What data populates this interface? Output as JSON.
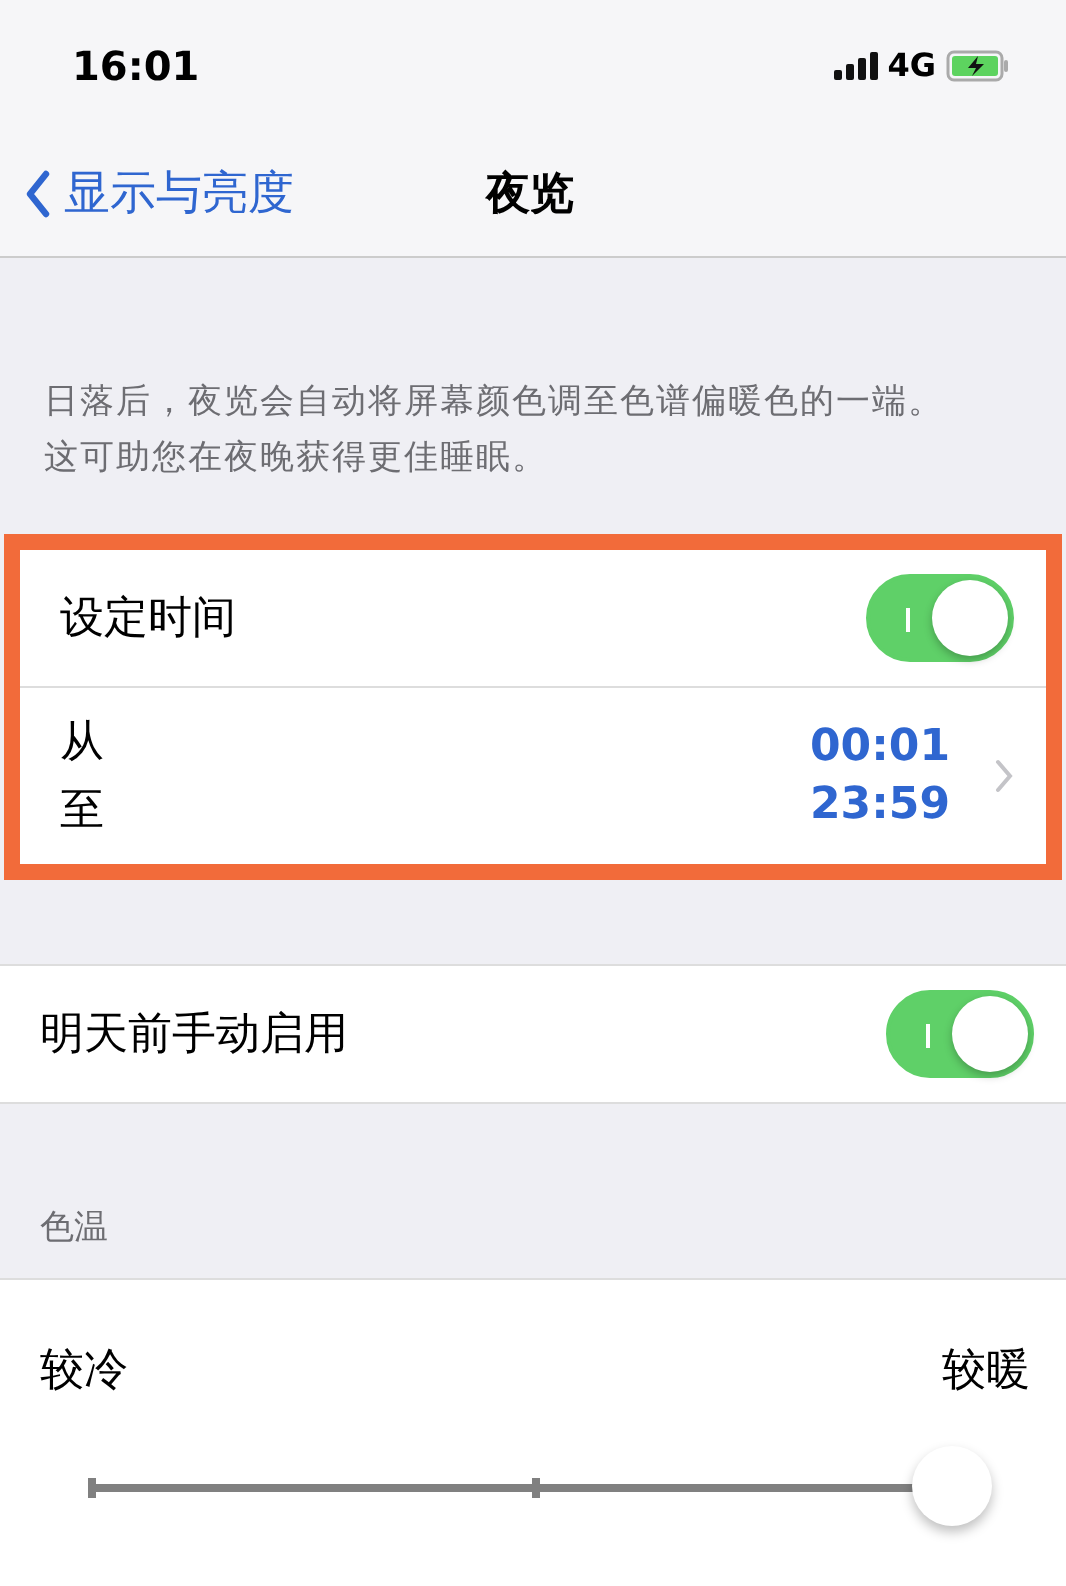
{
  "status_bar": {
    "time": "16:01",
    "network": "4G"
  },
  "nav": {
    "back": "显示与亮度",
    "title": "夜览"
  },
  "description": "日落后，夜览会自动将屏幕颜色调至色谱偏暖色的一端。这可助您在夜晚获得更佳睡眠。",
  "schedule": {
    "highlighted": true,
    "label": "设定时间",
    "on": true,
    "from_label": "从",
    "to_label": "至",
    "from": "00:01",
    "to": "23:59"
  },
  "manual": {
    "label": "明天前手动启用",
    "on": true
  },
  "temperature": {
    "header": "色温",
    "cool": "较冷",
    "warm": "较暖",
    "level": 0.97
  }
}
